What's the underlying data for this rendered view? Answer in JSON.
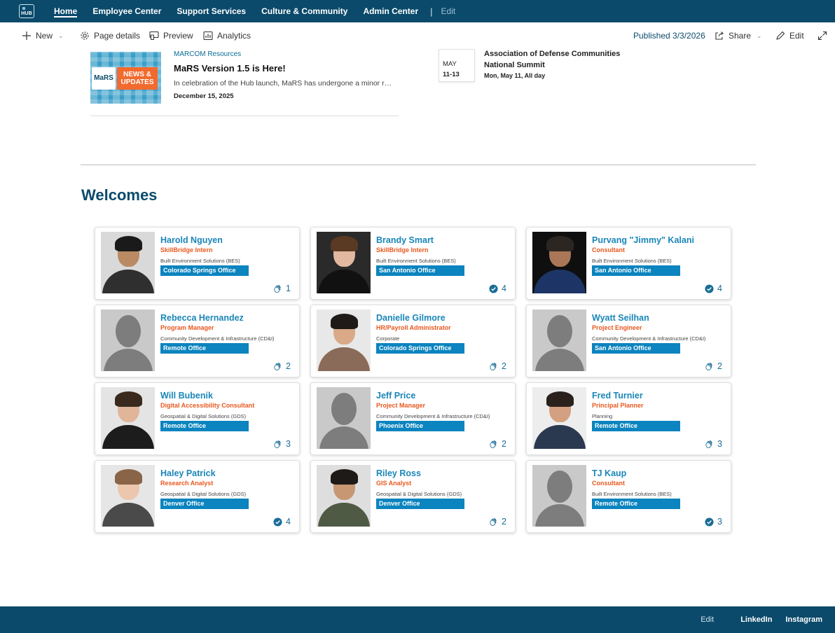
{
  "nav": {
    "items": [
      "Home",
      "Employee Center",
      "Support Services",
      "Culture & Community",
      "Admin Center"
    ],
    "separator": "|",
    "edit_label": "Edit"
  },
  "toolbar": {
    "new_label": "New",
    "page_details_label": "Page details",
    "preview_label": "Preview",
    "analytics_label": "Analytics",
    "published_label": "Published 3/3/2026",
    "share_label": "Share",
    "edit_label": "Edit"
  },
  "news": {
    "category": "MARCOM Resources",
    "title": "MaRS Version 1.5 is Here!",
    "description": "In celebration of the Hub launch, MaRS has undergone a minor refresh with new features and updates for everyone.",
    "date": "December 15, 2025",
    "image_badge": "MaRS",
    "image_caption_line1": "NEWS &",
    "image_caption_line2": "UPDATES"
  },
  "event": {
    "month": "MAY",
    "days": "11-13",
    "title": "Association of Defense Communities National Summit",
    "date_line": "Mon, May 11, All day"
  },
  "section_title": "Welcomes",
  "people": [
    {
      "name": "Harold Nguyen",
      "role": "SkillBridge Intern",
      "dept": "Built Environment Solutions (BES)",
      "office": "Colorado Springs Office",
      "reaction": "wave",
      "count": "1",
      "photo": "real",
      "skin": "#b98a63",
      "hair": "#1a1a1a",
      "shirt": "#2f2f2f",
      "bg": "#d9d9d9"
    },
    {
      "name": "Brandy Smart",
      "role": "SkillBridge Intern",
      "dept": "Built Environment Solutions (BES)",
      "office": "San Antonio Office",
      "reaction": "check",
      "count": "4",
      "photo": "real",
      "skin": "#e2b9a0",
      "hair": "#5a3a22",
      "shirt": "#111111",
      "bg": "#2a2a2a"
    },
    {
      "name": "Purvang \"Jimmy\" Kalani",
      "role": "Consultant",
      "dept": "Built Environment Solutions (BES)",
      "office": "San Antonio Office",
      "reaction": "check",
      "count": "4",
      "photo": "real",
      "skin": "#a97758",
      "hair": "#2b2622",
      "shirt": "#1d3566",
      "bg": "#0f0f0f"
    },
    {
      "name": "Rebecca Hernandez",
      "role": "Program Manager",
      "dept": "Community Development & Infrastructure (CD&I)",
      "office": "Remote Office",
      "reaction": "wave",
      "count": "2",
      "photo": "placeholder"
    },
    {
      "name": "Danielle Gilmore",
      "role": "HR/Payroll Administrator",
      "dept": "Corporate",
      "office": "Colorado Springs Office",
      "reaction": "wave",
      "count": "2",
      "photo": "real",
      "skin": "#d9a988",
      "hair": "#1f1a18",
      "shirt": "#8a6a58",
      "bg": "#e8e8e8"
    },
    {
      "name": "Wyatt Seilhan",
      "role": "Project Engineer",
      "dept": "Community Development & Infrastructure (CD&I)",
      "office": "San Antonio Office",
      "reaction": "wave",
      "count": "2",
      "photo": "placeholder"
    },
    {
      "name": "Will Bubenik",
      "role": "Digital Accessibility Consultant",
      "dept": "Geospatial & Digital Solutions (GDS)",
      "office": "Remote Office",
      "reaction": "wave",
      "count": "3",
      "photo": "real",
      "skin": "#e0b59a",
      "hair": "#3a2a1e",
      "shirt": "#1c1c1c",
      "bg": "#e4e4e4"
    },
    {
      "name": "Jeff Price",
      "role": "Project Manager",
      "dept": "Community Development & Infrastructure (CD&I)",
      "office": "Phoenix Office",
      "reaction": "wave",
      "count": "2",
      "photo": "placeholder"
    },
    {
      "name": "Fred Turnier",
      "role": "Principal Planner",
      "dept": "Planning",
      "office": "Remote Office",
      "reaction": "wave",
      "count": "3",
      "photo": "real",
      "skin": "#d3a081",
      "hair": "#2a211c",
      "shirt": "#2a3850",
      "bg": "#ededed"
    },
    {
      "name": "Haley Patrick",
      "role": "Research Analyst",
      "dept": "Geospatial & Digital Solutions (GDS)",
      "office": "Denver Office",
      "reaction": "check",
      "count": "4",
      "photo": "real",
      "skin": "#ecc6ad",
      "hair": "#8a6446",
      "shirt": "#4a4a4a",
      "bg": "#e6e6e6"
    },
    {
      "name": "Riley Ross",
      "role": "GIS Analyst",
      "dept": "Geospatial & Digital Solutions (GDS)",
      "office": "Denver Office",
      "reaction": "wave",
      "count": "2",
      "photo": "real",
      "skin": "#c79774",
      "hair": "#1e1a17",
      "shirt": "#4f5a45",
      "bg": "#dedede"
    },
    {
      "name": "TJ Kaup",
      "role": "Consultant",
      "dept": "Built Environment Solutions (BES)",
      "office": "Remote Office",
      "reaction": "check",
      "count": "3",
      "photo": "placeholder"
    }
  ],
  "footer": {
    "edit_label": "Edit",
    "links": [
      "LinkedIn",
      "Instagram"
    ]
  },
  "colors": {
    "brand": "#0b4a6b",
    "name_blue": "#1a86b8",
    "role_orange": "#e8581f",
    "office_blue": "#0b84bf"
  }
}
